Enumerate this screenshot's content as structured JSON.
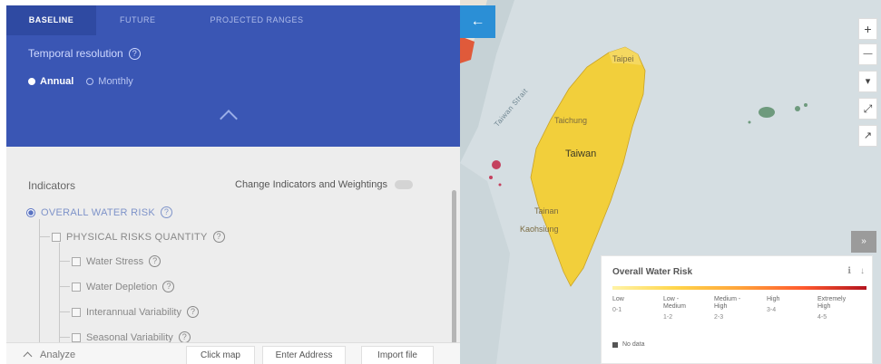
{
  "tabs": [
    {
      "label": "BASELINE",
      "active": true
    },
    {
      "label": "FUTURE",
      "active": false
    },
    {
      "label": "PROJECTED RANGES",
      "active": false
    }
  ],
  "temporal": {
    "label": "Temporal resolution",
    "help": "?"
  },
  "resolution_options": [
    {
      "label": "Annual",
      "selected": true
    },
    {
      "label": "Monthly",
      "selected": false
    }
  ],
  "indicators": {
    "title": "Indicators",
    "change_label": "Change Indicators and Weightings",
    "overall": "OVERALL WATER RISK",
    "physical": "PHYSICAL RISKS QUANTITY",
    "items": [
      "Water Stress",
      "Water Depletion",
      "Interannual Variability",
      "Seasonal Variability"
    ],
    "help": "?"
  },
  "bottom": {
    "analyze": "Analyze",
    "buttons": [
      "Click map",
      "Enter Address",
      "Import file"
    ]
  },
  "map": {
    "collapse_icon": "←",
    "zoom_in": "+",
    "zoom_out": "—",
    "controls": [
      "▾",
      "⤢",
      "↗"
    ],
    "labels": {
      "country": "Taiwan",
      "north": "Taipei",
      "west1": "Taichung",
      "west2": "Tainan",
      "south": "Kaohsiung",
      "sea": "Taiwan Strait"
    }
  },
  "legend": {
    "toggle": "»",
    "title": "Overall Water Risk",
    "icons": [
      "ℹ",
      "↓"
    ],
    "categories": [
      {
        "name": "Low",
        "range": "0-1"
      },
      {
        "name": "Low - Medium",
        "range": "1-2"
      },
      {
        "name": "Medium - High",
        "range": "2-3"
      },
      {
        "name": "High",
        "range": "3-4"
      },
      {
        "name": "Extremely High",
        "range": "4-5"
      }
    ],
    "no_data": "No data"
  },
  "colors": {
    "header_blue": "#3a56b4",
    "active_tab": "#2f4aa2",
    "map_button": "#2b8fd6",
    "land": "#f2cf3b"
  }
}
